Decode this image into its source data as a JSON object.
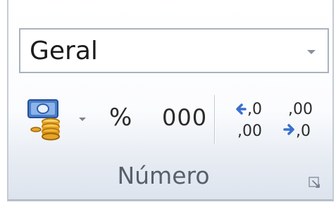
{
  "number_group": {
    "number_format": {
      "selected_value": "Geral"
    },
    "buttons": {
      "accounting_format": {
        "icon": "accounting-number-format-icon",
        "dropdown_icon": "chevron-down-icon"
      },
      "percent_style": {
        "label": "%"
      },
      "comma_style": {
        "label": "000"
      },
      "increase_decimal": {
        "icon": "increase-decimal-icon",
        "label_top": ",0",
        "label_bottom": ",00"
      },
      "decrease_decimal": {
        "icon": "decrease-decimal-icon",
        "label_top": ",00",
        "label_bottom": ",0"
      }
    },
    "group_label": "Número",
    "dialog_launcher_icon": "dialog-launcher-icon"
  },
  "colors": {
    "arrow_blue": "#3a6fd0",
    "coin_gold": "#e3a11e",
    "bill_blue": "#4a7fc9",
    "border": "#aab2bd",
    "group_label": "#575f6b"
  }
}
